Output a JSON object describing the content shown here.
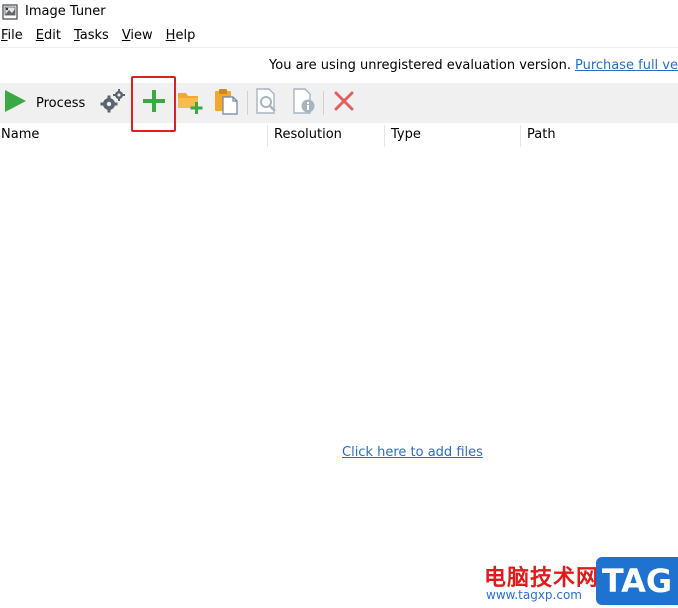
{
  "window": {
    "title": "Image Tuner",
    "app_icon": "image-tuner-app-icon"
  },
  "menu": [
    {
      "underline": "F",
      "rest": "ile"
    },
    {
      "underline": "E",
      "rest": "dit"
    },
    {
      "underline": "T",
      "rest": "asks"
    },
    {
      "underline": "V",
      "rest": "iew"
    },
    {
      "underline": "H",
      "rest": "elp"
    }
  ],
  "notice": {
    "text": "You are using unregistered evaluation version.",
    "link": "Purchase full ve"
  },
  "toolbar": {
    "process_label": "Process",
    "icons": [
      "play-icon",
      "settings-gears-icon",
      "add-files-icon",
      "add-folder-icon",
      "paste-icon",
      "preview-icon",
      "file-info-icon",
      "remove-icon"
    ],
    "colors": {
      "play": "#3aa844",
      "add": "#3aa844",
      "folder": "#f0a830",
      "remove": "#e06060",
      "disabled": "#a8b4c0"
    }
  },
  "columns": [
    "Name",
    "Resolution",
    "Type",
    "Path"
  ],
  "empty_hint": "Click here to add files",
  "watermark": {
    "text": "电脑技术网",
    "url": "www.tagxp.com",
    "badge": "TAG"
  }
}
